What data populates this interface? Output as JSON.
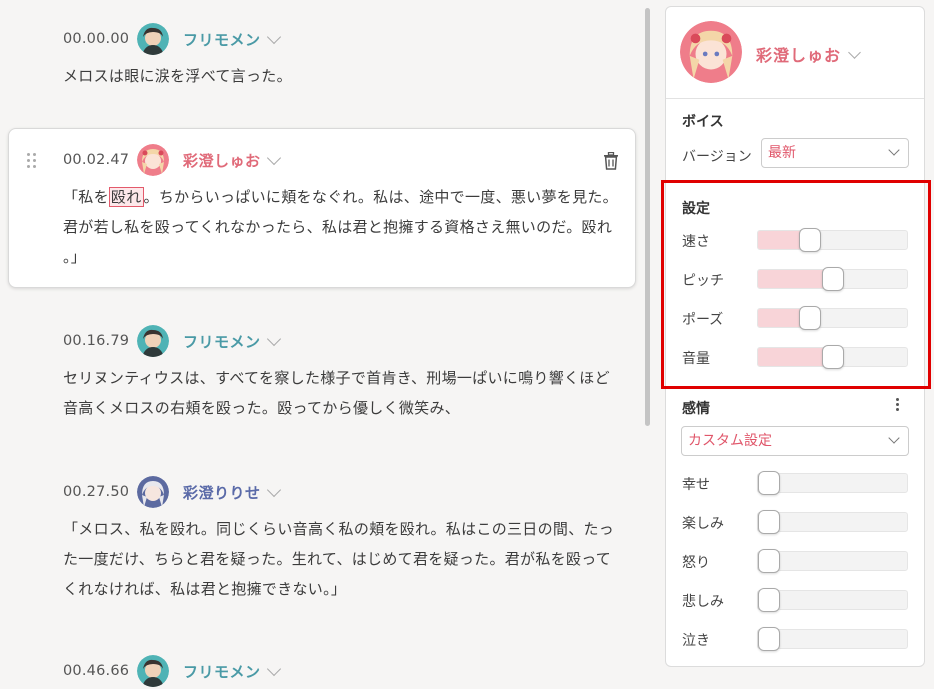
{
  "script": {
    "entries": [
      {
        "time": "00.00.00",
        "speaker": "フリモメン",
        "color": "#4a9aa6",
        "lines": [
          "メロスは眼に涙を浮べて言った。"
        ]
      },
      {
        "time": "00.02.47",
        "speaker": "彩澄しゅお",
        "color": "#e06a79",
        "text_pre": "「私を",
        "text_hl": "殴れ",
        "text_post": "。ちからいっぱいに頬をなぐれ。私は、途中で一度、悪い夢を見た。",
        "lines": [
          "君が若し私を殴ってくれなかったら、私は君と抱擁する資格さえ無いのだ。殴れ",
          "。」"
        ]
      },
      {
        "time": "00.16.79",
        "speaker": "フリモメン",
        "color": "#4a9aa6",
        "lines": [
          "セリヌンティウスは、すべてを察した様子で首肯き、刑場一ぱいに鳴り響くほど",
          "音高くメロスの右頬を殴った。殴ってから優しく微笑み、"
        ]
      },
      {
        "time": "00.27.50",
        "speaker": "彩澄りりせ",
        "color": "#5a6aa8",
        "lines": [
          "「メロス、私を殴れ。同じくらい音高く私の頬を殴れ。私はこの三日の間、たっ",
          "た一度だけ、ちらと君を疑った。生れて、はじめて君を疑った。君が私を殴って",
          "くれなければ、私は君と抱擁できない。」"
        ]
      },
      {
        "time": "00.46.66",
        "speaker": "フリモメン",
        "color": "#4a9aa6",
        "lines": []
      }
    ]
  },
  "panel": {
    "character_name": "彩澄しゅお",
    "voice": {
      "title": "ボイス",
      "version_label": "バージョン",
      "version_value": "最新"
    },
    "settings": {
      "title": "設定",
      "sliders": [
        {
          "label": "速さ",
          "value": 0.35
        },
        {
          "label": "ピッチ",
          "value": 0.5
        },
        {
          "label": "ポーズ",
          "value": 0.35
        },
        {
          "label": "音量",
          "value": 0.5
        }
      ]
    },
    "emotion": {
      "title": "感情",
      "preset": "カスタム設定",
      "sliders": [
        {
          "label": "幸せ",
          "value": 0
        },
        {
          "label": "楽しみ",
          "value": 0
        },
        {
          "label": "怒り",
          "value": 0
        },
        {
          "label": "悲しみ",
          "value": 0
        },
        {
          "label": "泣き",
          "value": 0
        }
      ]
    }
  }
}
